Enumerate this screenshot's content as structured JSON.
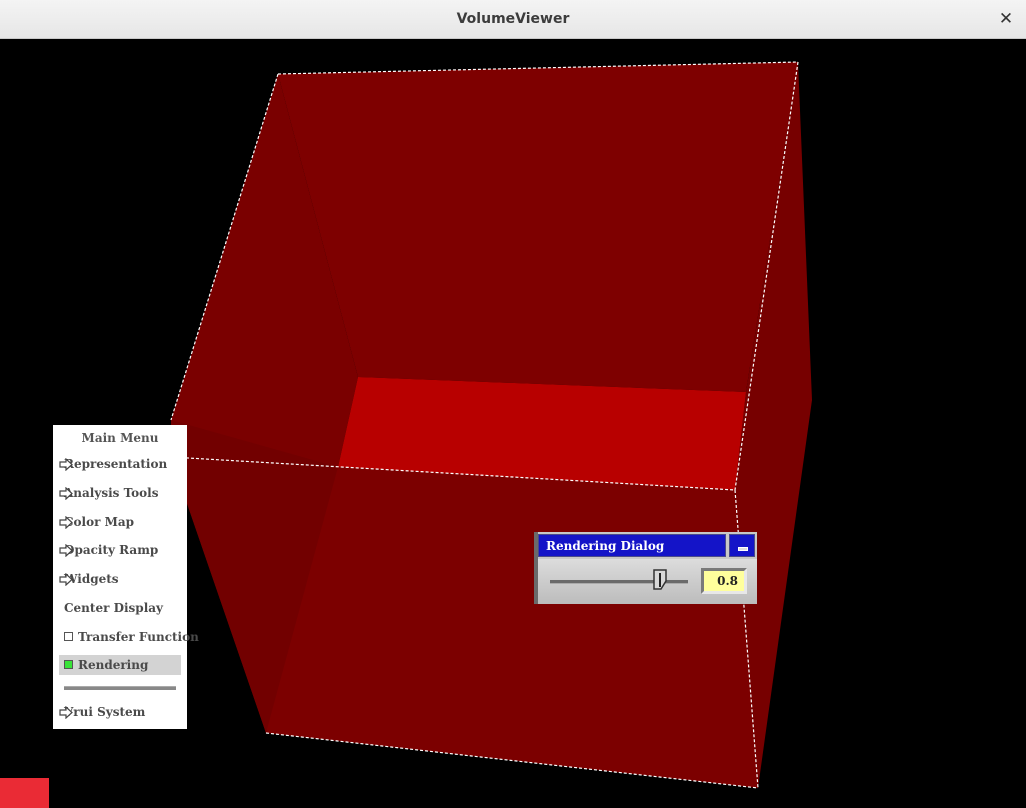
{
  "window": {
    "title": "VolumeViewer",
    "close_glyph": "✕"
  },
  "scene": {
    "background": "#000000",
    "cube_face_color": "#7a0000",
    "cube_floor_color": "#b80000",
    "edge_color": "#ffffff"
  },
  "main_menu": {
    "title": "Main Menu",
    "items": [
      {
        "label": "Representation",
        "submenu": true
      },
      {
        "label": "Analysis Tools",
        "submenu": true
      },
      {
        "label": "Color Map",
        "submenu": true
      },
      {
        "label": "Opacity Ramp",
        "submenu": true
      },
      {
        "label": "Widgets",
        "submenu": true
      },
      {
        "label": "Center Display",
        "submenu": false
      },
      {
        "label": "Transfer Function",
        "toggle": true,
        "checked": false
      },
      {
        "label": "Rendering",
        "toggle": true,
        "checked": true
      },
      {
        "label": "Vrui System",
        "submenu": true
      }
    ]
  },
  "rendering_dialog": {
    "title": "Rendering Dialog",
    "slider_value": "0.8",
    "slider_fraction": 0.8,
    "minimize_icon": "minimize-icon"
  },
  "colors": {
    "dialog_title_bg": "#1414c8",
    "value_field_bg": "#ffff9c",
    "toggle_on": "#39e339",
    "corner_marker": "#ea2b35"
  }
}
